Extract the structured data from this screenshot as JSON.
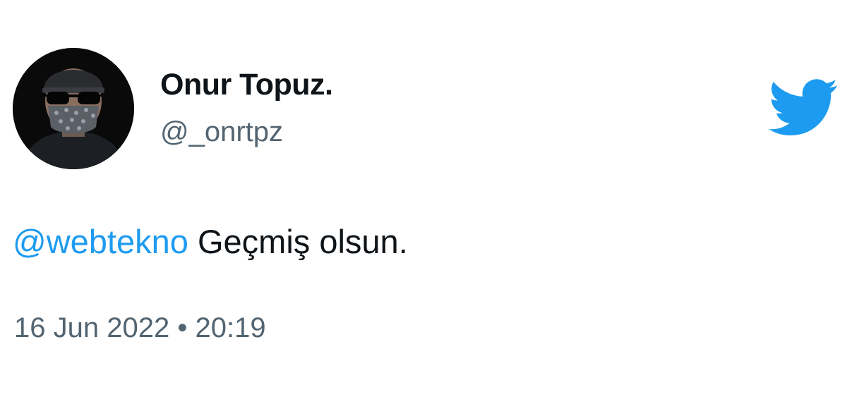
{
  "tweet": {
    "author": {
      "display_name": "Onur Topuz.",
      "handle": "@_onrtpz"
    },
    "text": {
      "mention": "@webtekno",
      "body": "Geçmiş olsun."
    },
    "timestamp": {
      "date": "16 Jun 2022",
      "separator": "•",
      "time": "20:19"
    }
  },
  "icons": {
    "brand": "twitter-bird-icon",
    "avatar": "user-avatar"
  },
  "colors": {
    "brand_blue": "#1d9bf0",
    "text_primary": "#0f1419",
    "text_secondary": "#536471",
    "background": "#ffffff"
  }
}
